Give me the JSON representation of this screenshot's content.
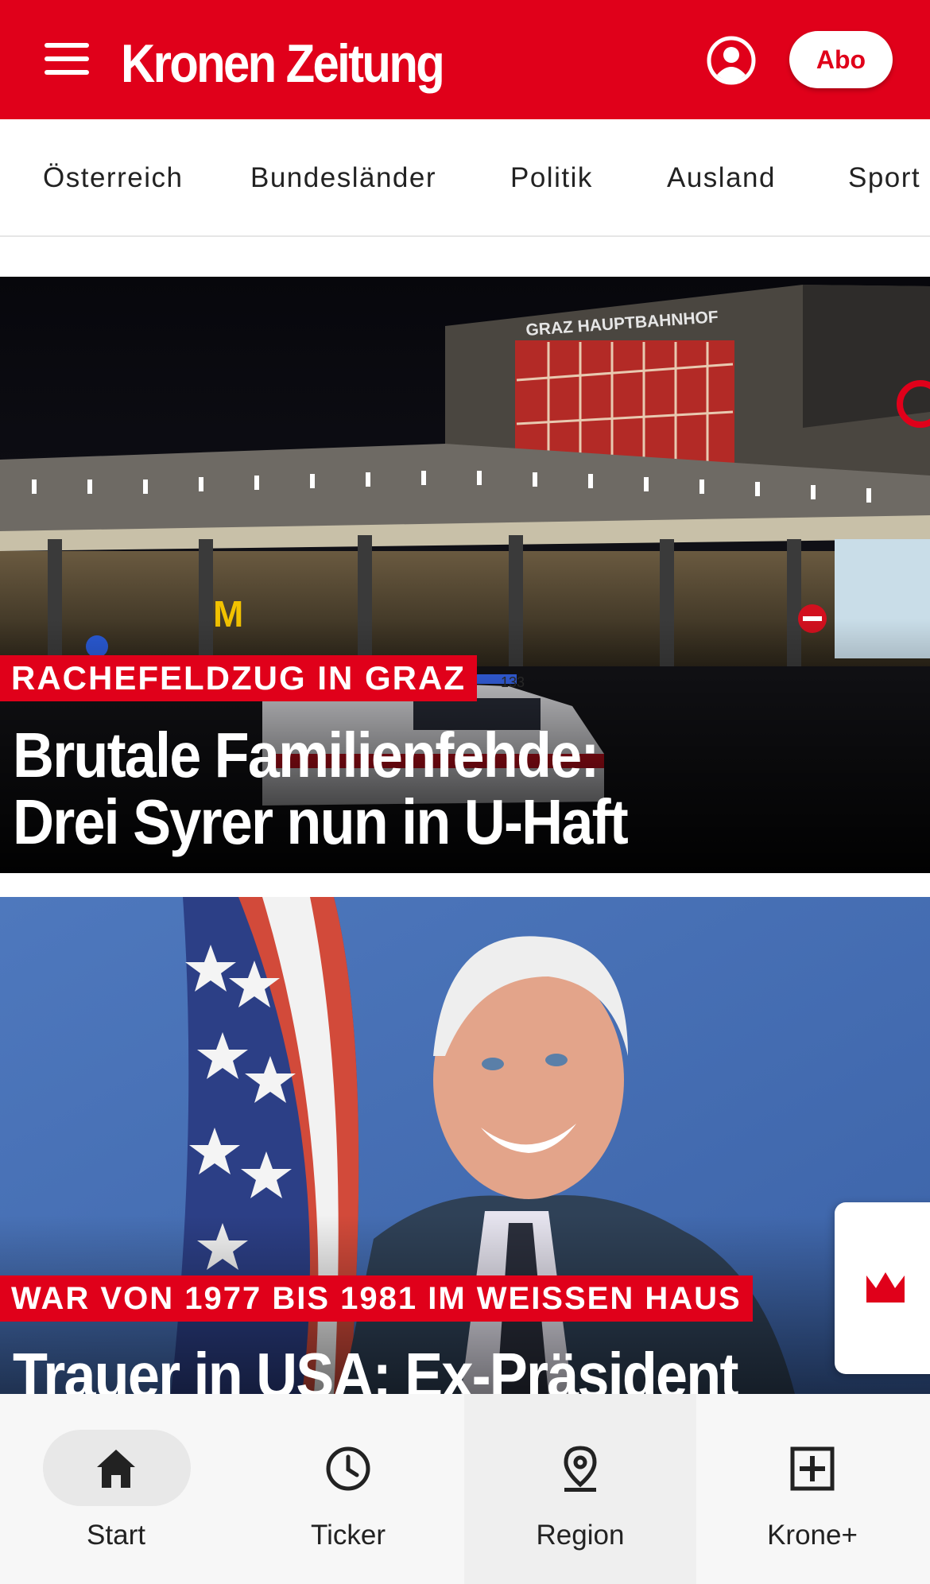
{
  "header": {
    "logo": "Kronen Zeitung",
    "abo_label": "Abo"
  },
  "categories": [
    "Österreich",
    "Bundesländer",
    "Politik",
    "Ausland",
    "Sport"
  ],
  "articles": [
    {
      "kicker": "RACHEFELDZUG IN GRAZ",
      "headline_line1": "Brutale Familienfehde:",
      "headline_line2": "Drei Syrer nun in U-Haft",
      "image_sign": "GRAZ HAUPTBAHNHOF",
      "police_car_number": "133"
    },
    {
      "kicker": "WAR VON 1977 BIS 1981 IM WEISSEN HAUS",
      "headline_line1": "Trauer in USA: Ex-Präsident"
    }
  ],
  "bottom_nav": [
    {
      "label": "Start",
      "icon": "home-icon"
    },
    {
      "label": "Ticker",
      "icon": "clock-icon"
    },
    {
      "label": "Region",
      "icon": "location-pin-icon"
    },
    {
      "label": "Krone+",
      "icon": "plus-square-icon"
    }
  ],
  "colors": {
    "brand_red": "#e0001a"
  }
}
